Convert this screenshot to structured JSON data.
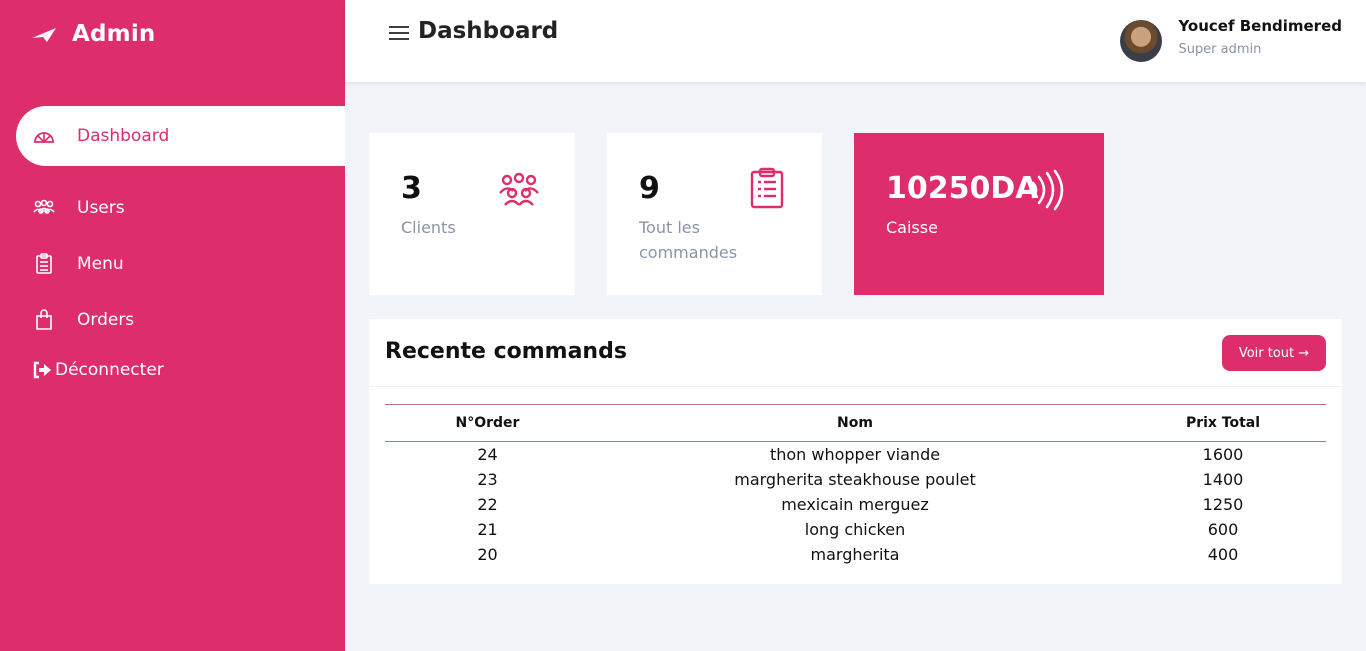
{
  "brand": {
    "title": "Admin"
  },
  "colors": {
    "accent": "#de2d6b",
    "background": "#f1f5f9"
  },
  "sidebar": {
    "items": [
      {
        "label": "Dashboard",
        "icon": "dashboard-icon",
        "active": true
      },
      {
        "label": "Users",
        "icon": "users-icon"
      },
      {
        "label": "Menu",
        "icon": "clipboard-icon"
      },
      {
        "label": "Orders",
        "icon": "shopping-bag-icon"
      }
    ],
    "logout": {
      "label": "Déconnecter",
      "icon": "sign-out-icon"
    }
  },
  "header": {
    "title": "Dashboard",
    "user": {
      "name": "Youcef Bendimered",
      "role": "Super admin"
    }
  },
  "cards": [
    {
      "value": "3",
      "label": "Clients",
      "icon": "users-icon"
    },
    {
      "value": "9",
      "label": "Tout les commandes",
      "icon": "clipboard-icon"
    },
    {
      "value": "10250DA",
      "label": "Caisse",
      "icon": "contactless-icon"
    }
  ],
  "recent": {
    "title": "Recente commands",
    "button": "Voir tout →",
    "columns": [
      "N°Order",
      "Nom",
      "Prix Total"
    ],
    "rows": [
      [
        "24",
        "thon whopper viande",
        "1600"
      ],
      [
        "23",
        "margherita steakhouse poulet",
        "1400"
      ],
      [
        "22",
        "mexicain merguez",
        "1250"
      ],
      [
        "21",
        "long chicken",
        "600"
      ],
      [
        "20",
        "margherita",
        "400"
      ]
    ]
  }
}
